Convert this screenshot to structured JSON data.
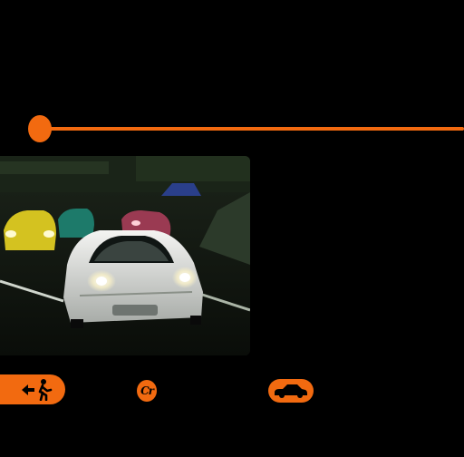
{
  "theme": {
    "accent": "#f26a10",
    "background": "#000000"
  },
  "timeline": {
    "position": 0.0
  },
  "preview": {
    "subject": "white-sports-car-night-race"
  },
  "controls": {
    "exit_icon": "exit-person-icon",
    "credits_icon_text": "Cr",
    "garage_icon": "car-icon"
  }
}
